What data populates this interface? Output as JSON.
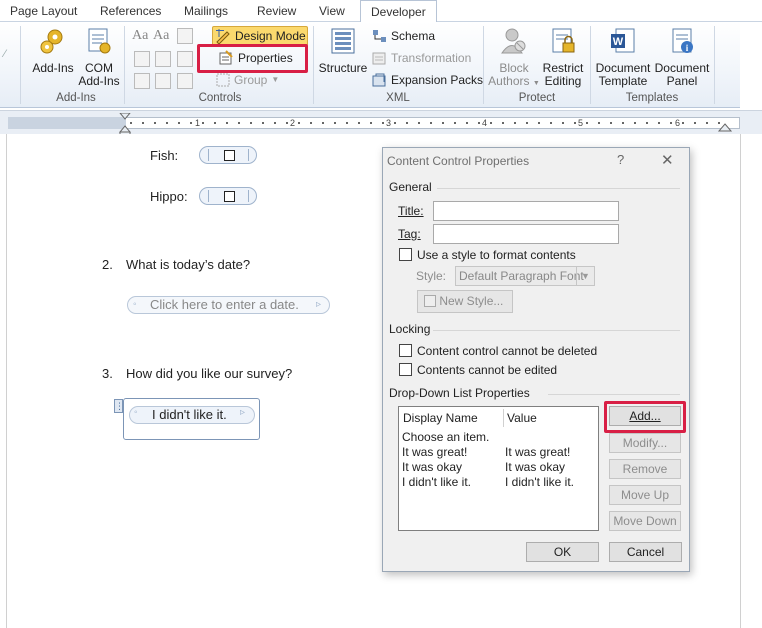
{
  "tabs": [
    "Page Layout",
    "References",
    "Mailings",
    "Review",
    "View",
    "Developer"
  ],
  "ribbon": {
    "addins": {
      "addins_label": "Add-Ins",
      "com_label_1": "COM",
      "com_label_2": "Add-Ins",
      "group": "Add-Ins"
    },
    "controls": {
      "design_mode": "Design Mode",
      "properties": "Properties",
      "group_btn": "Group",
      "group": "Controls"
    },
    "xml": {
      "structure": "Structure",
      "schema": "Schema",
      "transformation": "Transformation",
      "expansion_packs": "Expansion Packs",
      "group": "XML"
    },
    "protect": {
      "block_1": "Block",
      "block_2": "Authors",
      "restrict_1": "Restrict",
      "restrict_2": "Editing",
      "group": "Protect"
    },
    "templates": {
      "doc_tpl_1": "Document",
      "doc_tpl_2": "Template",
      "doc_panel_1": "Document",
      "doc_panel_2": "Panel",
      "group": "Templates"
    }
  },
  "ruler": {
    "numbers": [
      "1",
      "2",
      "3",
      "4",
      "5",
      "6"
    ]
  },
  "document": {
    "fish_label": "Fish:",
    "hippo_label": "Hippo:",
    "q2_num": "2.",
    "q2_text": "What is today’s date?",
    "date_placeholder": "Click here to enter a date.",
    "q3_num": "3.",
    "q3_text": "How did you like our survey?",
    "dropdown_value": "I didn't like it."
  },
  "dialog": {
    "title": "Content Control Properties",
    "help": "?",
    "close": "✕",
    "general": "General",
    "title_label": "Title:",
    "title_value": "",
    "tag_label": "Tag:",
    "tag_value": "",
    "use_style": "Use a style to format contents",
    "style_label": "Style:",
    "style_value": "Default Paragraph Font",
    "new_style": "New Style...",
    "locking": "Locking",
    "lock_delete": "Content control cannot be deleted",
    "lock_edit": "Contents cannot be edited",
    "dropdown_props": "Drop-Down List Properties",
    "col_display": "Display Name",
    "col_value": "Value",
    "items": [
      {
        "display": "Choose an item.",
        "value": ""
      },
      {
        "display": "It was great!",
        "value": "It was great!"
      },
      {
        "display": "It was okay",
        "value": "It was okay"
      },
      {
        "display": "I didn't like it.",
        "value": "I didn't like it."
      }
    ],
    "buttons": {
      "add": "Add...",
      "modify": "Modify...",
      "remove": "Remove",
      "move_up": "Move Up",
      "move_down": "Move Down"
    },
    "ok": "OK",
    "cancel": "Cancel"
  },
  "colors": {
    "highlight": "#d81f45",
    "design_mode_bg": "#fbd96e"
  }
}
